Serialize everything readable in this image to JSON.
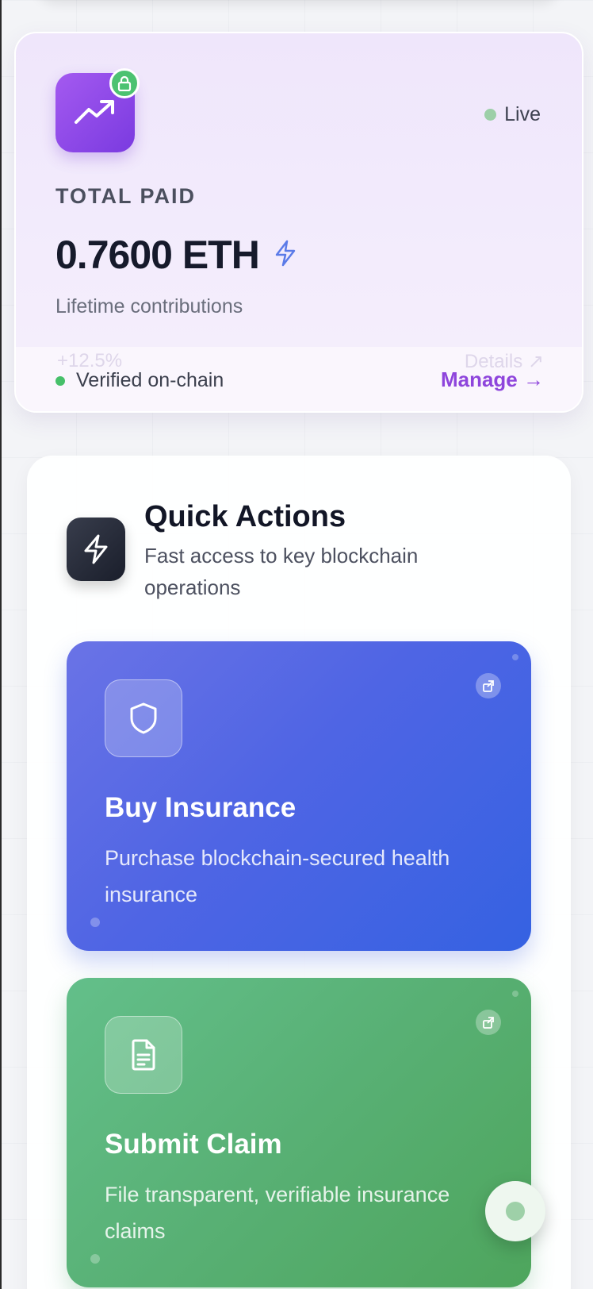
{
  "stat_card": {
    "live_label": "Live",
    "label": "TOTAL PAID",
    "value": "0.7600 ETH",
    "subtitle": "Lifetime contributions",
    "ghost_change": "+12.5%",
    "ghost_details": "Details ↗",
    "verified_label": "Verified on-chain",
    "manage_label": "Manage →",
    "icon": "trending-up-icon",
    "badge_icon": "lock-icon",
    "value_icon": "lightning-icon"
  },
  "quick_actions": {
    "title": "Quick Actions",
    "subtitle": "Fast access to key blockchain operations",
    "icon": "lightning-icon",
    "cards": [
      {
        "title": "Buy Insurance",
        "description": "Purchase blockchain-secured health insurance",
        "icon": "shield-icon",
        "color": "#4f65e4"
      },
      {
        "title": "Submit Claim",
        "description": "File transparent, verifiable insurance claims",
        "icon": "document-icon",
        "color": "#58b074"
      }
    ]
  },
  "colors": {
    "accent_purple": "#8e45dc",
    "live_green": "#46c06a",
    "text_dark": "#161a2b"
  }
}
